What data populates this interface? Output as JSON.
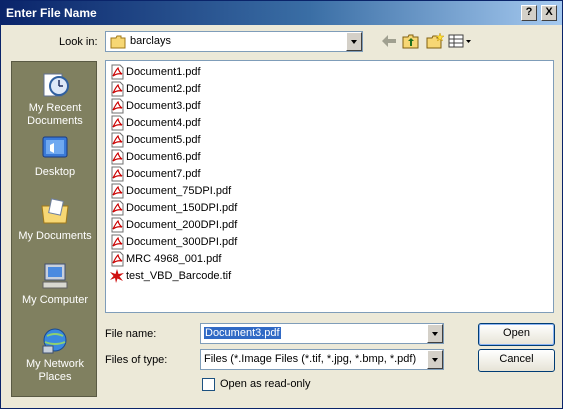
{
  "window": {
    "title": "Enter File Name",
    "help_glyph": "?",
    "close_glyph": "X"
  },
  "lookin": {
    "label": "Look in:",
    "value": "barclays"
  },
  "places": [
    {
      "label_line1": "My Recent",
      "label_line2": "Documents",
      "icon": "recent-documents-icon"
    },
    {
      "label_line1": "Desktop",
      "label_line2": "",
      "icon": "desktop-icon"
    },
    {
      "label_line1": "My Documents",
      "label_line2": "",
      "icon": "my-documents-icon"
    },
    {
      "label_line1": "My Computer",
      "label_line2": "",
      "icon": "my-computer-icon"
    },
    {
      "label_line1": "My Network",
      "label_line2": "Places",
      "icon": "network-places-icon"
    }
  ],
  "files": [
    {
      "name": "Document1.pdf",
      "type": "pdf"
    },
    {
      "name": "Document2.pdf",
      "type": "pdf"
    },
    {
      "name": "Document3.pdf",
      "type": "pdf"
    },
    {
      "name": "Document4.pdf",
      "type": "pdf"
    },
    {
      "name": "Document5.pdf",
      "type": "pdf"
    },
    {
      "name": "Document6.pdf",
      "type": "pdf"
    },
    {
      "name": "Document7.pdf",
      "type": "pdf"
    },
    {
      "name": "Document_75DPI.pdf",
      "type": "pdf"
    },
    {
      "name": "Document_150DPI.pdf",
      "type": "pdf"
    },
    {
      "name": "Document_200DPI.pdf",
      "type": "pdf"
    },
    {
      "name": "Document_300DPI.pdf",
      "type": "pdf"
    },
    {
      "name": "MRC 4968_001.pdf",
      "type": "pdf"
    },
    {
      "name": "test_VBD_Barcode.tif",
      "type": "tif"
    }
  ],
  "filename": {
    "label": "File name:",
    "value": "Document3.pdf"
  },
  "filetype": {
    "label": "Files of type:",
    "value": "Files (*.Image Files (*.tif, *.jpg, *.bmp, *.pdf)"
  },
  "readonly": {
    "label": "Open as read-only",
    "checked": false
  },
  "buttons": {
    "open": "Open",
    "cancel": "Cancel"
  },
  "colors": {
    "title_bar": "#0a246a",
    "places_bar": "#808060",
    "selection": "#316ac5",
    "pdf_icon": "#cc0000"
  }
}
